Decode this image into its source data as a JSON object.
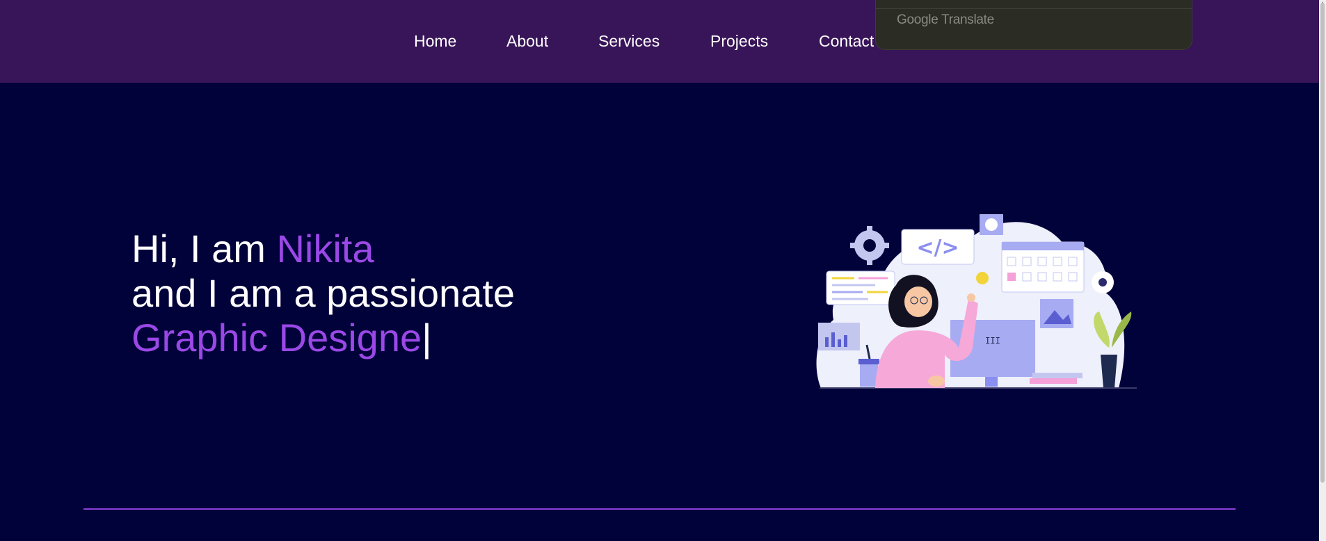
{
  "nav": {
    "items": [
      {
        "label": "Home"
      },
      {
        "label": "About"
      },
      {
        "label": "Services"
      },
      {
        "label": "Projects"
      },
      {
        "label": "Contact"
      }
    ]
  },
  "translate_popup": {
    "brand_google": "Google",
    "brand_translate": "Translate"
  },
  "hero": {
    "greeting_prefix": "Hi, I am ",
    "name": "Nikita",
    "line2": "and I am a passionate",
    "role_typed": "Graphic Designe",
    "cursor": "|"
  },
  "illustration": {
    "icon": "designer-at-computer-illustration",
    "code_tag": "</>"
  },
  "colors": {
    "navbar_bg": "#381458",
    "page_bg": "#02023a",
    "accent": "#9a48e6",
    "divider": "#8a3fd8"
  }
}
